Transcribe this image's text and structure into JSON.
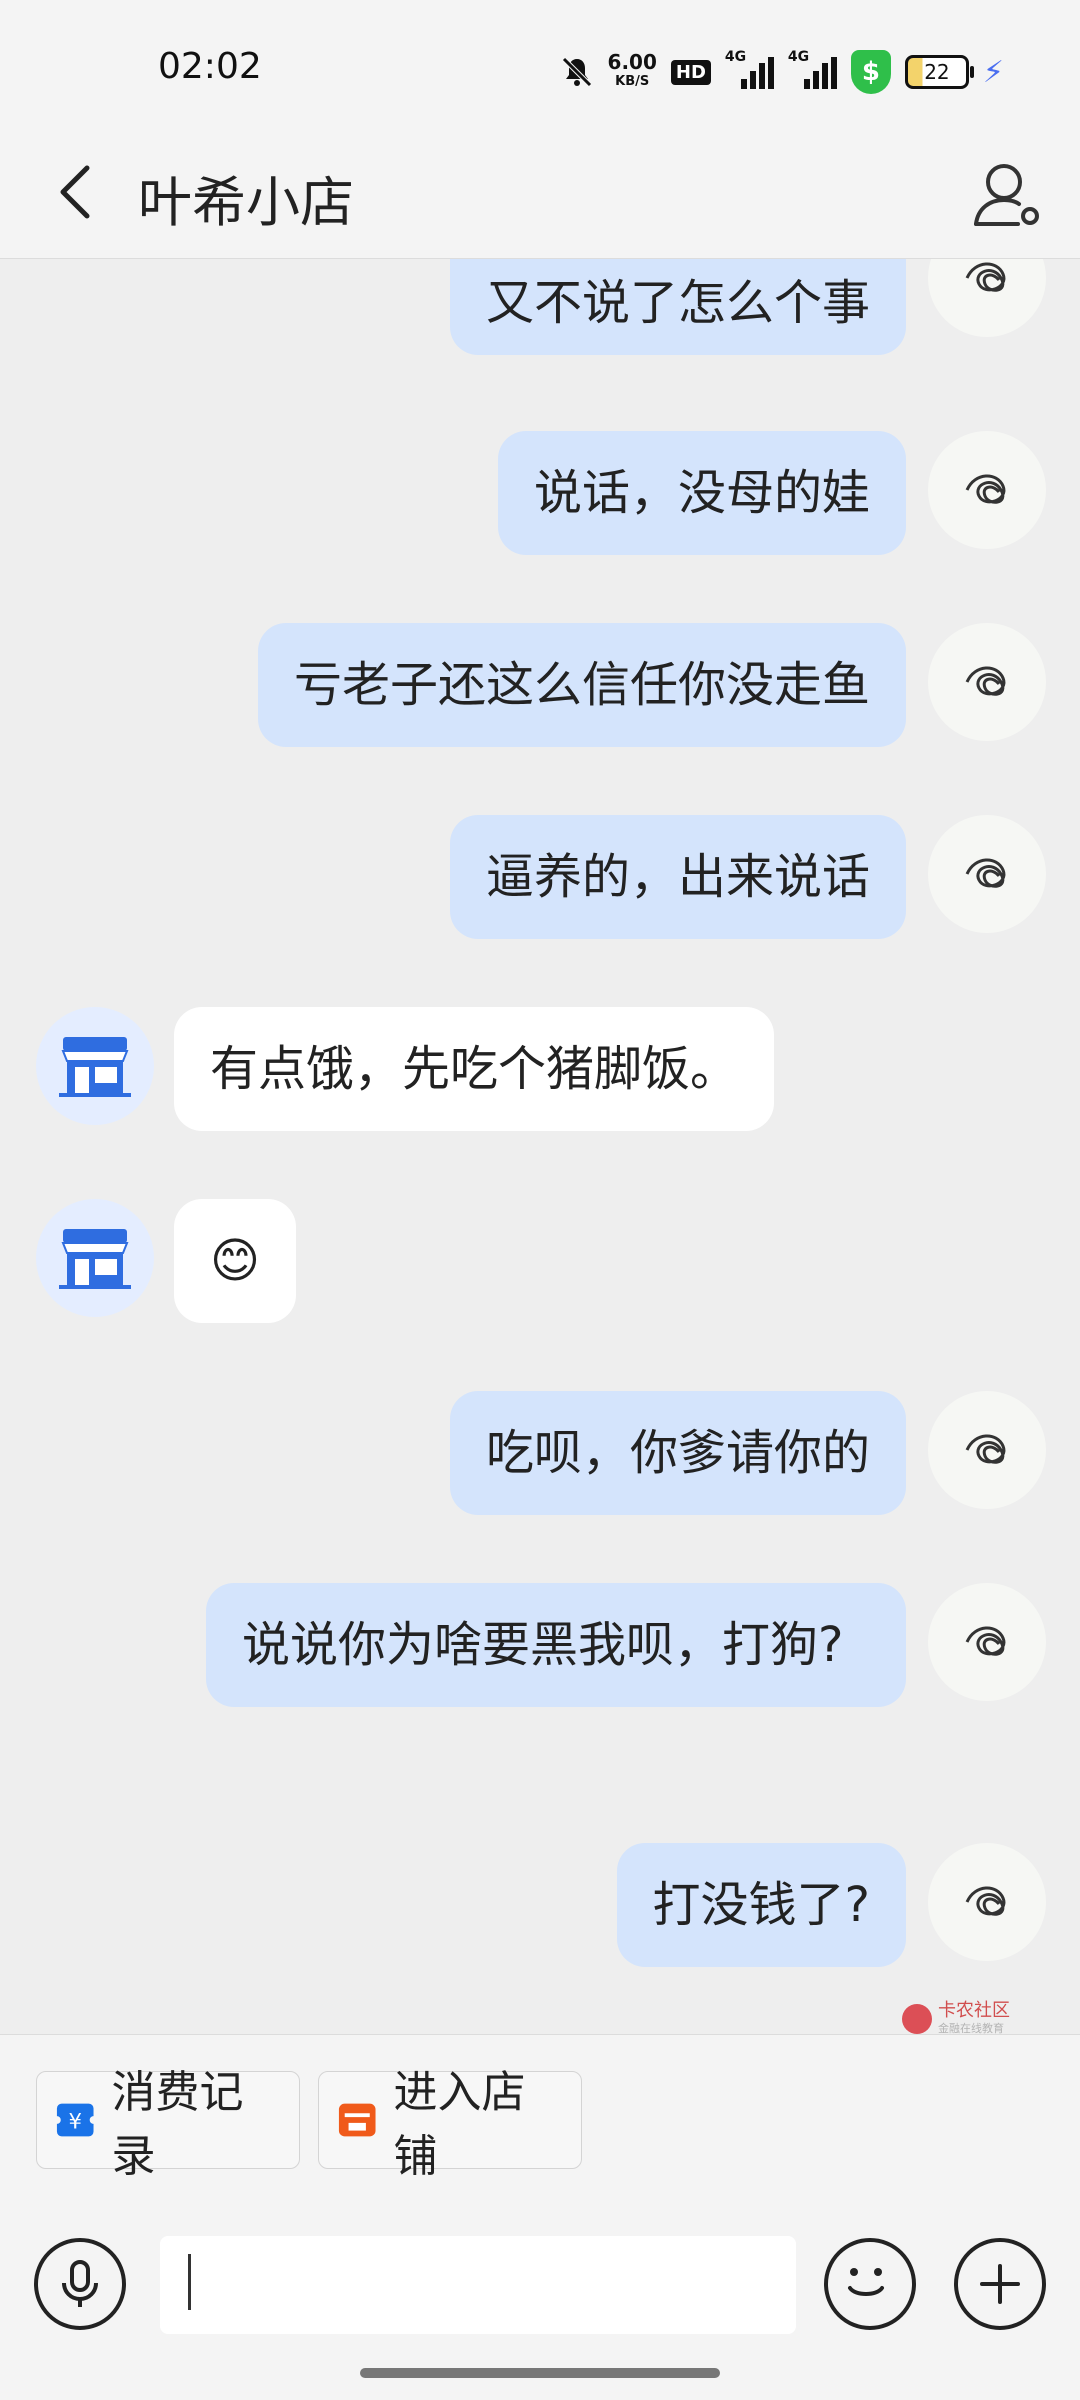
{
  "status_bar": {
    "time": "02:02",
    "net_speed_value": "6.00",
    "net_speed_unit": "KB/S",
    "hd_label": "HD",
    "sim1_label": "4G",
    "sim2_label": "4G",
    "shield_symbol": "$",
    "battery_level": "22",
    "icons": [
      "mute-bell-icon",
      "hd-icon",
      "signal-icon",
      "shield-icon",
      "battery-icon",
      "charging-icon"
    ]
  },
  "header": {
    "title": "叶希小店",
    "back_icon": "chevron-left-icon",
    "profile_icon": "user-settings-icon"
  },
  "messages": [
    {
      "sender": "me",
      "text": "又不说了怎么个事"
    },
    {
      "sender": "me",
      "text": "说话，没母的娃"
    },
    {
      "sender": "me",
      "text": "亏老子还这么信任你没走鱼"
    },
    {
      "sender": "me",
      "text": "逼养的，出来说话"
    },
    {
      "sender": "shop",
      "text": "有点饿，先吃个猪脚饭。"
    },
    {
      "sender": "shop",
      "text": "😊"
    },
    {
      "sender": "me",
      "text": "吃呗，你爹请你的"
    },
    {
      "sender": "me",
      "text": "说说你为啥要黑我呗，打狗?"
    },
    {
      "sender": "me",
      "text": "打没钱了?"
    }
  ],
  "quick_actions": {
    "records_label": "消费记录",
    "shop_label": "进入店铺",
    "records_icon": "ticket-icon",
    "shop_icon": "store-icon",
    "records_color": "#1a73e8",
    "shop_color": "#f05a1a"
  },
  "input_bar": {
    "value": "",
    "placeholder": ""
  },
  "watermark": {
    "title": "卡农社区",
    "subtitle": "金融在线教育"
  },
  "colors": {
    "my_bubble": "#d4e4fc",
    "shop_bubble": "#ffffff",
    "background": "#eeeeee"
  }
}
